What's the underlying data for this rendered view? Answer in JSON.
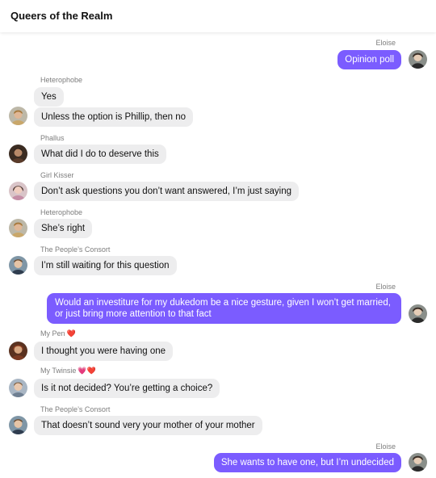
{
  "chat": {
    "title": "Queers of the Realm"
  },
  "messages": [
    {
      "sender": "Eloise",
      "text": "Opinion poll"
    },
    {
      "sender": "Heterophobe",
      "text": "Yes"
    },
    {
      "text": "Unless the option is Phillip, then no"
    },
    {
      "sender": "Phallus",
      "text": "What did I do to deserve this"
    },
    {
      "sender": "Girl Kisser",
      "text": "Don’t ask questions you don’t want answered, I’m just saying"
    },
    {
      "sender": "Heterophobe",
      "text": "She’s right"
    },
    {
      "sender": "The People’s Consort",
      "text": "I’m still waiting for this question"
    },
    {
      "sender": "Eloise",
      "text": "Would an investiture for my dukedom be a nice gesture, given I won’t get married, or just bring more attention to that fact"
    },
    {
      "sender": "My Pen",
      "hearts": "❤️",
      "text": "I thought you were having one"
    },
    {
      "sender": "My Twinsie",
      "hearts": "💗❤️",
      "text": "Is it not decided? You’re getting a choice?"
    },
    {
      "sender": "The People’s Consort",
      "text": "That doesn’t sound very your mother of your mother"
    },
    {
      "sender": "Eloise",
      "text": "She wants to have one, but I’m undecided"
    }
  ],
  "colors": {
    "outgoing_bubble": "#7b5cff",
    "incoming_bubble": "#ededee",
    "sender_label": "#7d7d7d"
  },
  "icons": {
    "heart_red": "❤️",
    "heart_pink": "💗"
  }
}
